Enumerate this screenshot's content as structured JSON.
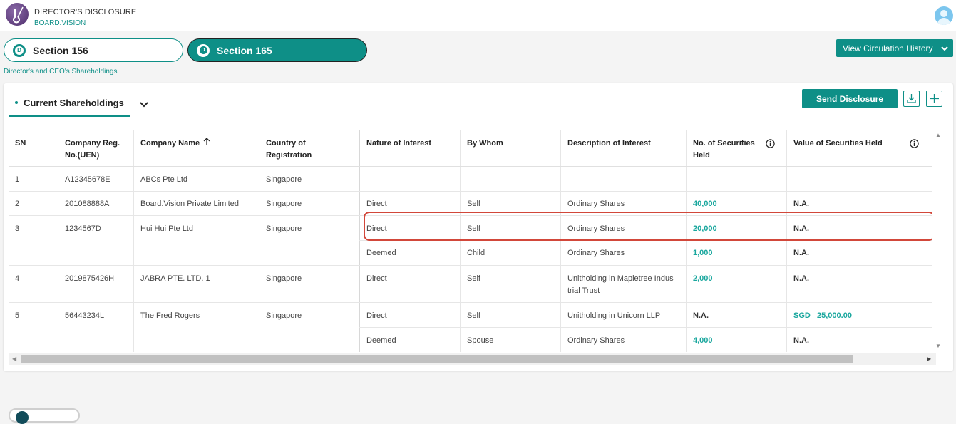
{
  "app": {
    "title": "DIRECTOR'S DISCLOSURE",
    "subtitle": "BOARD.VISION"
  },
  "tabs": [
    {
      "badge": "D",
      "label": "Section 156"
    },
    {
      "badge": "D",
      "label": "Section 165"
    }
  ],
  "circulation_button": "View Circulation History",
  "page_subtitle": "Director's and CEO's Shareholdings",
  "current_tab": "Current Shareholdings",
  "send_button": "Send Disclosure",
  "colors": {
    "accent": "#0e8f87",
    "highlight": "#d2473a"
  },
  "table": {
    "headers": {
      "sn": "SN",
      "reg_1": "Company Reg.",
      "reg_2": "No.(UEN)",
      "name": "Company Name",
      "country_1": "Country of",
      "country_2": "Registration",
      "nature": "Nature of Interest",
      "by": "By Whom",
      "desc": "Description of Interest",
      "secs_1": "No. of Securities",
      "secs_2": "Held",
      "value": "Value of Securities Held"
    },
    "companies": [
      {
        "sn": "1",
        "reg": "A12345678E",
        "name": "ABCs Pte Ltd",
        "country": "Singapore"
      },
      {
        "sn": "2",
        "reg": "201088888A",
        "name": "Board.Vision Private Limited",
        "country": "Singapore"
      },
      {
        "sn": "3",
        "reg": "1234567D",
        "name": "Hui Hui Pte Ltd",
        "country": "Singapore"
      },
      {
        "sn": "4",
        "reg": "2019875426H",
        "name": "JABRA PTE. LTD. 1",
        "country": "Singapore"
      },
      {
        "sn": "5",
        "reg": "56443234L",
        "name": "The Fred Rogers",
        "country": "Singapore"
      }
    ],
    "interests": [
      {
        "nature": "Direct",
        "by": "Self",
        "desc": "Ordinary Shares",
        "secs": "40,000",
        "value": "N.A."
      },
      {
        "nature": "Direct",
        "by": "Self",
        "desc": "Ordinary Shares",
        "secs": "20,000",
        "value": "N.A."
      },
      {
        "nature": "Deemed",
        "by": "Child",
        "desc": "Ordinary Shares",
        "secs": "1,000",
        "value": "N.A."
      },
      {
        "nature": "Direct",
        "by": "Self",
        "desc_1": "Unitholding in Mapletree Indus",
        "desc_2": "trial Trust",
        "secs": "2,000",
        "value": "N.A."
      },
      {
        "nature": "Direct",
        "by": "Self",
        "desc": "Unitholding in Unicorn LLP",
        "secs": "N.A.",
        "value_currency": "SGD",
        "value_amount": "25,000.00"
      },
      {
        "nature": "Deemed",
        "by": "Spouse",
        "desc": "Ordinary Shares",
        "secs": "4,000",
        "value": "N.A."
      }
    ]
  }
}
